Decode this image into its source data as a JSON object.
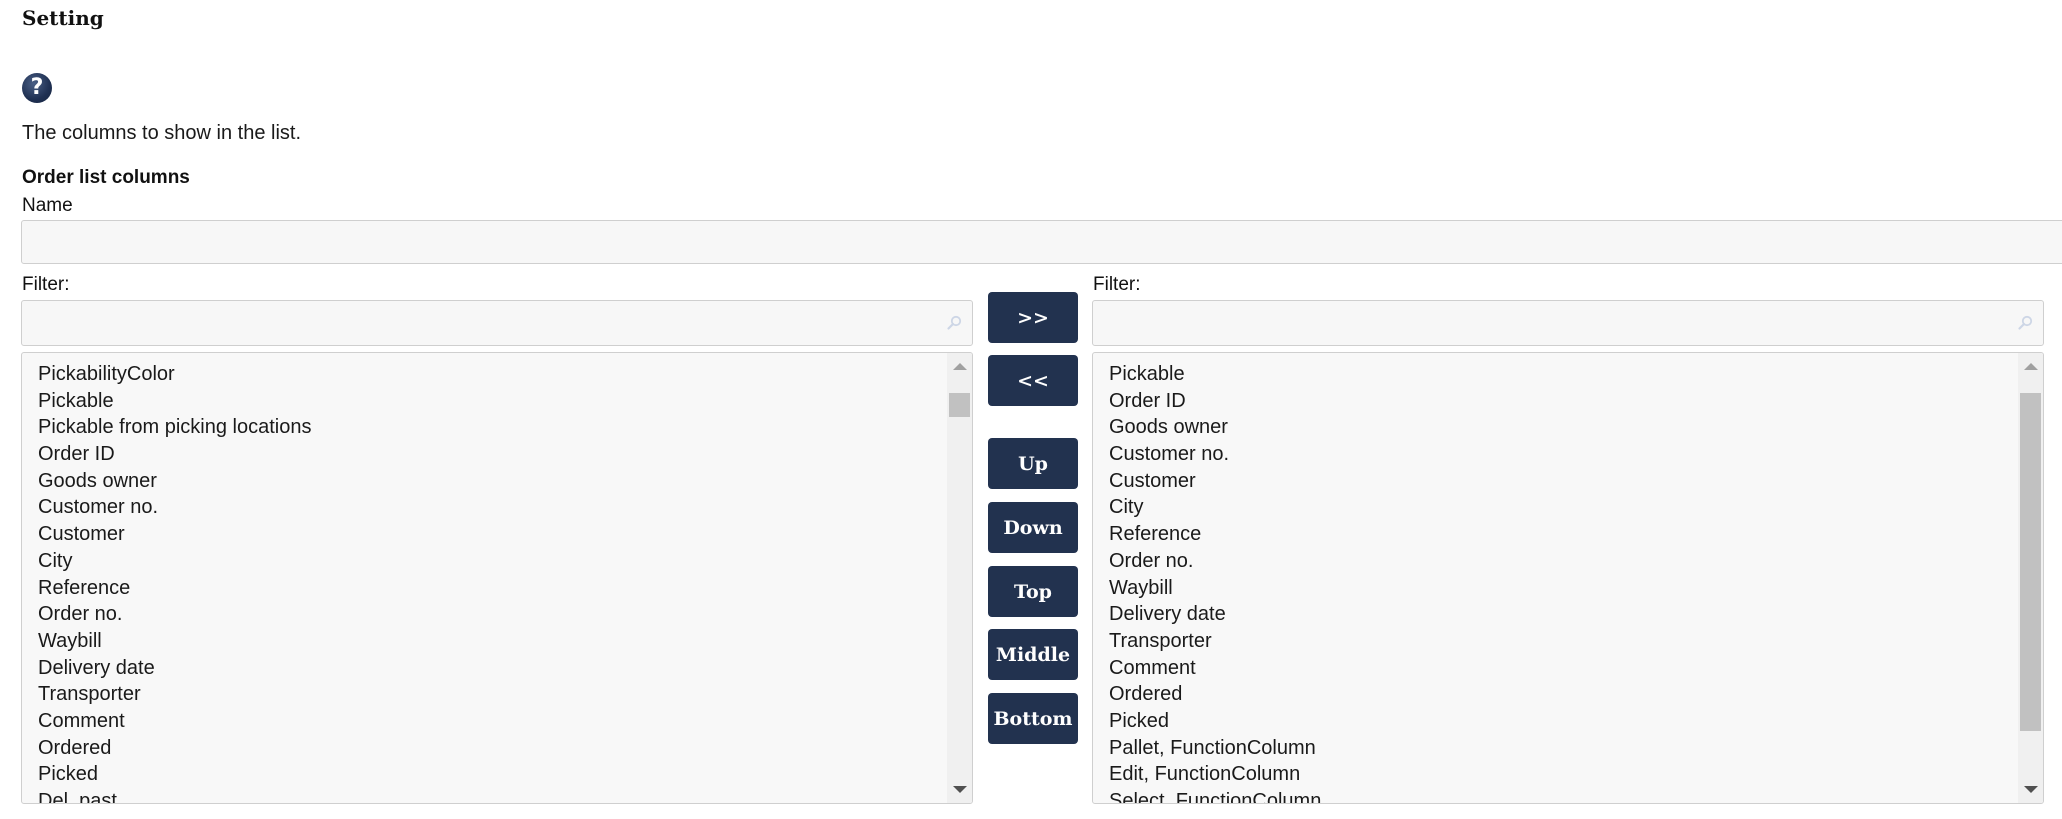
{
  "header": {
    "title": "Setting"
  },
  "help": {
    "icon": "help-circle-icon",
    "glyph": "?"
  },
  "description": "The columns to show in the list.",
  "section": {
    "label": "Order list columns"
  },
  "name_field": {
    "label": "Name",
    "value": "",
    "placeholder": ""
  },
  "available": {
    "filter_label": "Filter:",
    "filter_value": "",
    "filter_icon": "search-icon",
    "items": [
      "PickabilityColor",
      "Pickable",
      "Pickable from picking locations",
      "Order ID",
      "Goods owner",
      "Customer no.",
      "Customer",
      "City",
      "Reference",
      "Order no.",
      "Waybill",
      "Delivery date",
      "Transporter",
      "Comment",
      "Ordered",
      "Picked",
      "Del. past"
    ],
    "scroll": {
      "thumb_start_fraction": 0.04,
      "visible_fraction": 0.06
    }
  },
  "selected": {
    "filter_label": "Filter:",
    "filter_value": "",
    "filter_icon": "search-icon",
    "items": [
      "Pickable",
      "Order ID",
      "Goods owner",
      "Customer no.",
      "Customer",
      "City",
      "Reference",
      "Order no.",
      "Waybill",
      "Delivery date",
      "Transporter",
      "Comment",
      "Ordered",
      "Picked",
      "Pallet, FunctionColumn",
      "Edit, FunctionColumn",
      "Select, FunctionColumn"
    ],
    "scroll": {
      "thumb_start_fraction": 0.04,
      "visible_fraction": 0.84
    }
  },
  "buttons": {
    "add": ">>",
    "remove": "<<",
    "up": "Up",
    "down": "Down",
    "top": "Top",
    "middle": "Middle",
    "bottom": "Bottom"
  },
  "colors": {
    "button_bg": "#22324f",
    "button_text": "#ffffff",
    "input_bg": "#f7f7f7",
    "border": "#cfcfcf"
  }
}
